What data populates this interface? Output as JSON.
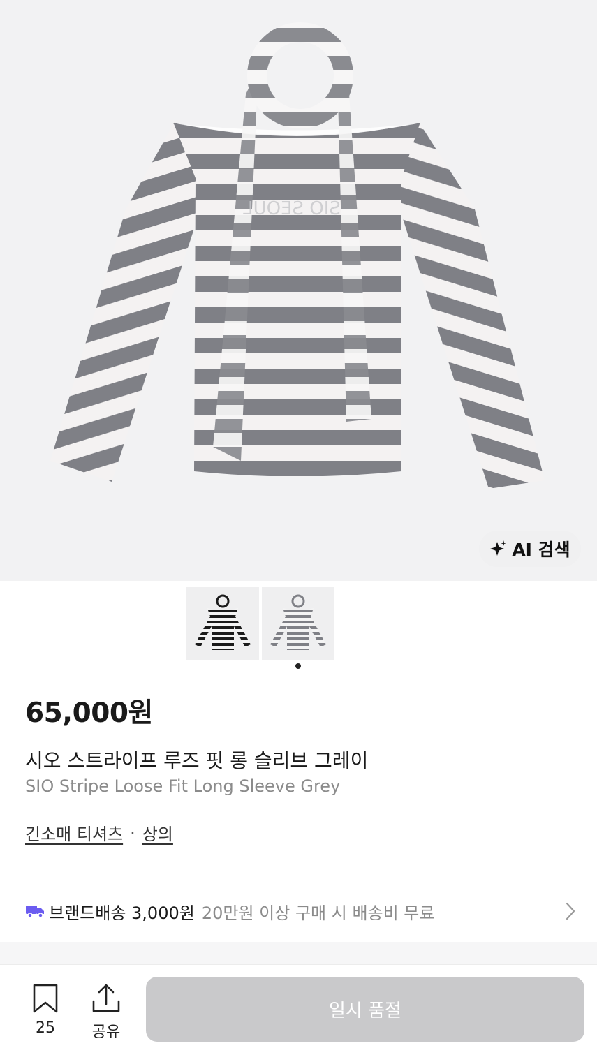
{
  "hero": {
    "print_text": "SIO SEOUL",
    "ai_search_label": "AI 검색",
    "ai_icon": "sparkle-icon"
  },
  "gallery": {
    "thumbnails": [
      {
        "name": "black-stripe-thumbnail",
        "stripe_color": "#1b1b1b"
      },
      {
        "name": "grey-stripe-thumbnail",
        "stripe_color": "#7f8086"
      }
    ],
    "active_index": 1
  },
  "product": {
    "price": "65,000원",
    "name_ko": "시오 스트라이프 루즈 핏 롱 슬리브 그레이",
    "name_en": "SIO Stripe Loose Fit Long Sleeve Grey",
    "category_1": "긴소매 티셔츠",
    "category_separator": "·",
    "category_2": "상의"
  },
  "shipping": {
    "icon": "truck-icon",
    "label": "브랜드배송 3,000원",
    "note": "20만원 이상 구매 시 배송비 무료",
    "accent": "#6b5cf0"
  },
  "bottom_bar": {
    "bookmark_count": "25",
    "share_label": "공유",
    "soldout_label": "일시 품절"
  },
  "colors": {
    "stripe_grey": "#7f8086",
    "stripe_light": "#f4f2f2",
    "hero_bg": "#f2f2f3",
    "soldout_bg": "#c9c9cb"
  }
}
